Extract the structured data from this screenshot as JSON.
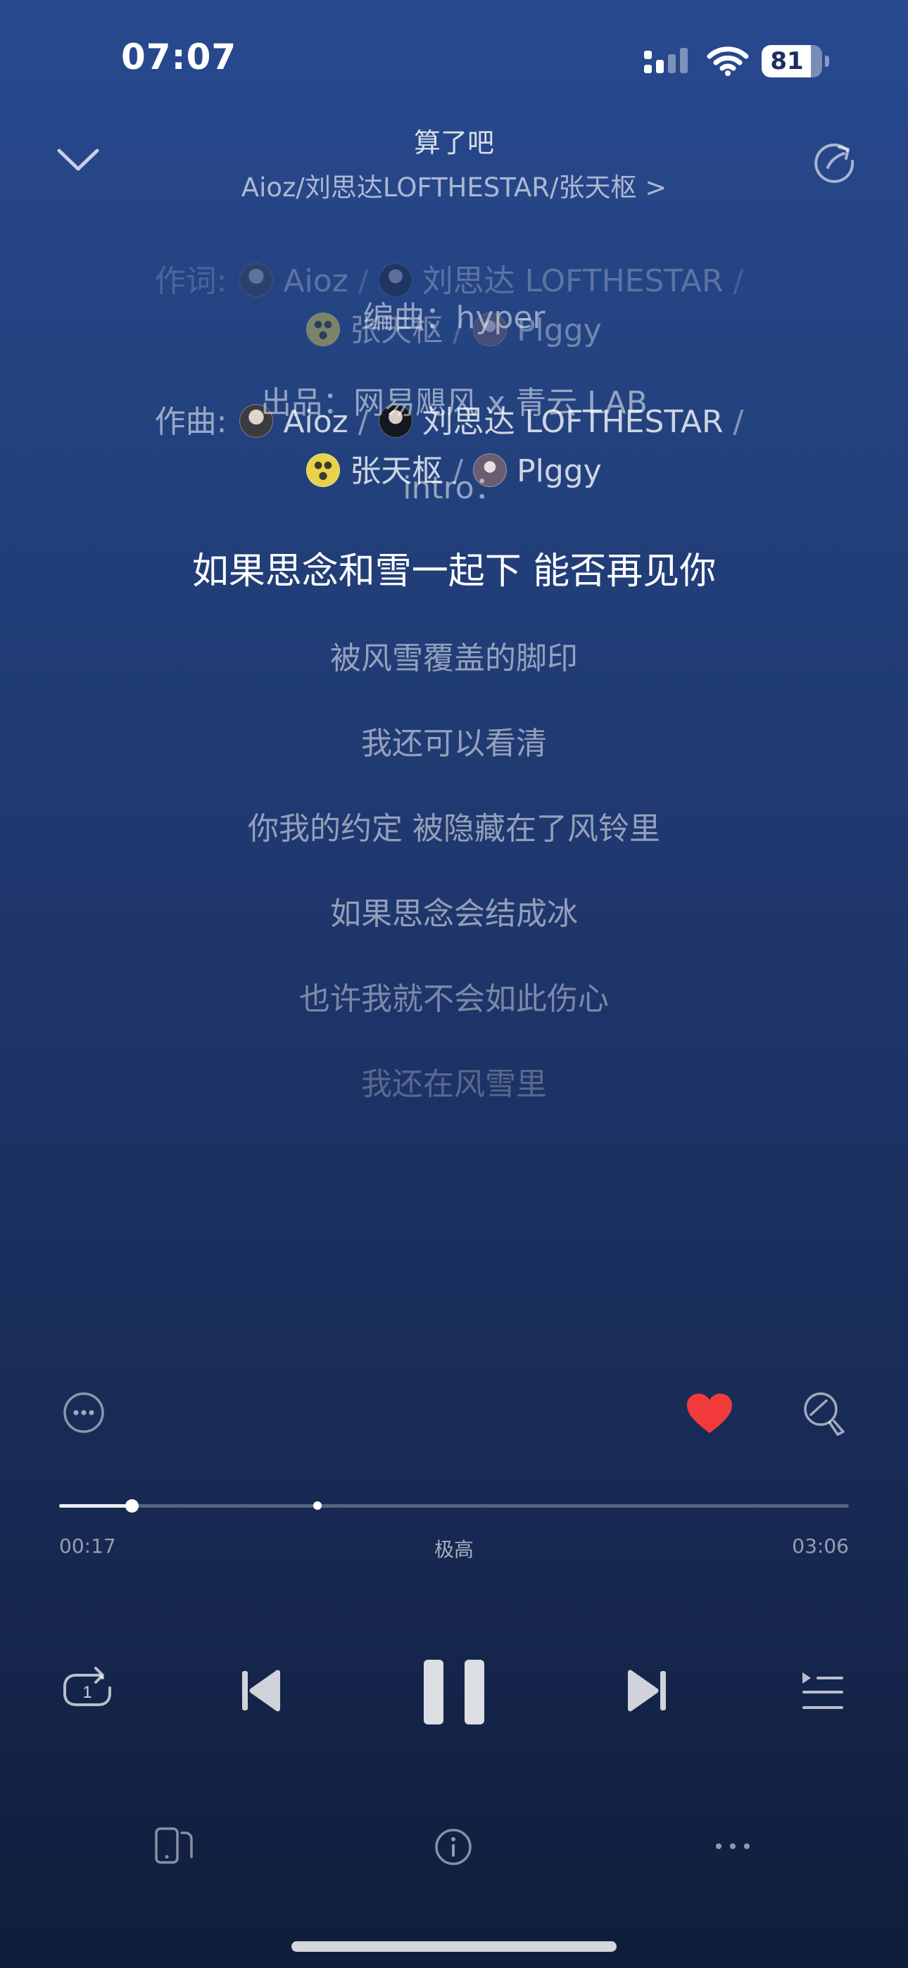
{
  "status_bar": {
    "time": "07:07",
    "battery_level": "81",
    "battery_fraction": 0.81
  },
  "header": {
    "title": "算了吧",
    "artists": "Aioz/刘思达LOFTHESTAR/张天枢 >"
  },
  "credits": {
    "lyricist_label": "作词:",
    "composer_label": "作曲:",
    "lyricist_names": [
      {
        "name": "Aioz",
        "avatar": "aioz"
      },
      {
        "name": "刘思达 LOFTHESTAR",
        "avatar": "liu"
      },
      {
        "name": "张天枢",
        "avatar": "zhang"
      },
      {
        "name": "Plggy",
        "avatar": "plggy"
      }
    ],
    "composer_names": [
      {
        "name": "Aioz",
        "avatar": "aioz"
      },
      {
        "name": "刘思达 LOFTHESTAR",
        "avatar": "liu"
      },
      {
        "name": "张天枢",
        "avatar": "zhang"
      },
      {
        "name": "Plggy",
        "avatar": "plggy"
      }
    ],
    "separator": "/"
  },
  "lyrics": [
    {
      "text": "编曲：hyper",
      "current": false
    },
    {
      "text": "出品：网易飓风 x 青云 LAB",
      "current": false
    },
    {
      "text": "intro：",
      "current": false
    },
    {
      "text": "如果思念和雪一起下 能否再见你",
      "current": true
    },
    {
      "text": "被风雪覆盖的脚印",
      "current": false
    },
    {
      "text": "我还可以看清",
      "current": false
    },
    {
      "text": "你我的约定 被隐藏在了风铃里",
      "current": false
    },
    {
      "text": "如果思念会结成冰",
      "current": false
    },
    {
      "text": "也许我就不会如此伤心",
      "current": false
    },
    {
      "text": "我还在风雪里",
      "current": false
    }
  ],
  "actions": {
    "more_icon": "ellipsis-circle-icon",
    "like_icon": "heart-icon",
    "like_color": "#f23a3a",
    "liked": true,
    "comment_icon": "comment-bubble-icon"
  },
  "progress": {
    "elapsed": "00:17",
    "total": "03:06",
    "quality": "极高",
    "played_fraction": 0.0914,
    "marker_fraction": 0.327
  },
  "controls": {
    "repeat_icon": "repeat-one-icon",
    "previous_icon": "previous-track-icon",
    "pause_icon": "pause-icon",
    "next_icon": "next-track-icon",
    "playlist_icon": "playlist-icon"
  },
  "bottom_bar": {
    "devices_icon": "device-switch-icon",
    "info_icon": "info-icon",
    "more_icon": "more-dots-icon"
  }
}
